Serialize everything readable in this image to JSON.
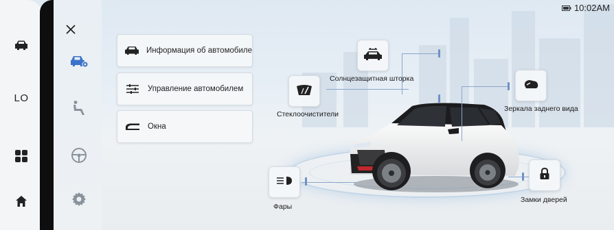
{
  "status_bar": {
    "time": "10:02AM",
    "battery_icon": "battery-icon"
  },
  "rail": {
    "mode_label": "LO",
    "icons": [
      "car-icon",
      "apps-grid-icon",
      "home-icon"
    ]
  },
  "panel": {
    "close_icon": "close-icon",
    "category_icons": [
      "car-settings-icon",
      "seat-icon",
      "steering-wheel-icon",
      "gear-icon"
    ]
  },
  "menu": {
    "items": [
      {
        "label": "Информация об автомобиле",
        "icon": "car-info-icon"
      },
      {
        "label": "Управление автомобилем",
        "icon": "sliders-icon"
      },
      {
        "label": "Окна",
        "icon": "window-icon"
      }
    ]
  },
  "features": {
    "sunshade": {
      "label": "Солнцезащитная шторка",
      "icon": "sunroof-car-icon"
    },
    "wipers": {
      "label": "Стеклоочистители",
      "icon": "wiper-icon"
    },
    "mirrors": {
      "label": "Зеркала заднего вида",
      "icon": "mirror-icon"
    },
    "lights": {
      "label": "Фары",
      "icon": "headlight-icon"
    },
    "locks": {
      "label": "Замки дверей",
      "icon": "lock-icon"
    }
  },
  "colors": {
    "accent": "#3a73c9",
    "rail_bg": "#f3f5f7",
    "strip": "#0e0e0e"
  }
}
